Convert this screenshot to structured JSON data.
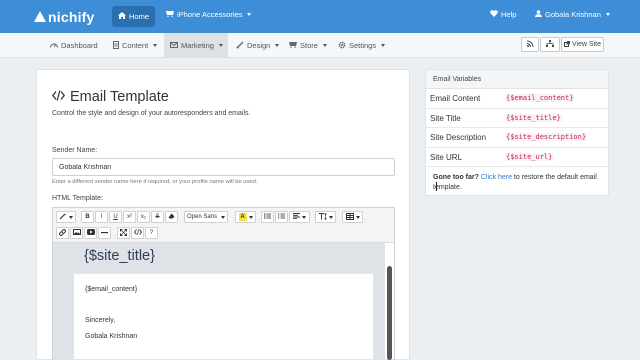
{
  "topbar": {
    "logo": "nichify",
    "home": "Home",
    "store": "iPhone Accessories",
    "help": "Help",
    "user": "Gobala Krishnan",
    "color": "#3d8ed6"
  },
  "subnav": {
    "items": [
      {
        "icon": "dashboard-icon",
        "label": "Dashboard"
      },
      {
        "icon": "content-icon",
        "label": "Content"
      },
      {
        "icon": "envelope-icon",
        "label": "Marketing"
      },
      {
        "icon": "brush-icon",
        "label": "Design"
      },
      {
        "icon": "cart-icon",
        "label": "Store"
      },
      {
        "icon": "gear-icon",
        "label": "Settings"
      }
    ],
    "view_site": "View Site"
  },
  "main": {
    "title": "Email Template",
    "subtitle": "Control the style and design of your autoresponders and emails.",
    "sender_label": "Sender Name:",
    "sender_value": "Gobala Krishnan",
    "sender_help": "Enter a different sender name here if required, or your profile name will be used.",
    "html_label": "HTML Template:",
    "font_select": "Open Sans",
    "editor": {
      "title": "{$site_title}",
      "content": "{$email_content}",
      "sincerely": "Sincerely,",
      "name": "Gobala Krishnan"
    }
  },
  "sidebar": {
    "header": "Email Variables",
    "variables": [
      {
        "name": "Email Content",
        "code": "{$email_content}"
      },
      {
        "name": "Site Title",
        "code": "{$site_title}"
      },
      {
        "name": "Site Description",
        "code": "{$site_description}"
      },
      {
        "name": "Site URL",
        "code": "{$site_url}"
      }
    ],
    "note_bold": "Gone too far?",
    "note_link": "Click here",
    "note_rest": "to restore the default email template."
  }
}
